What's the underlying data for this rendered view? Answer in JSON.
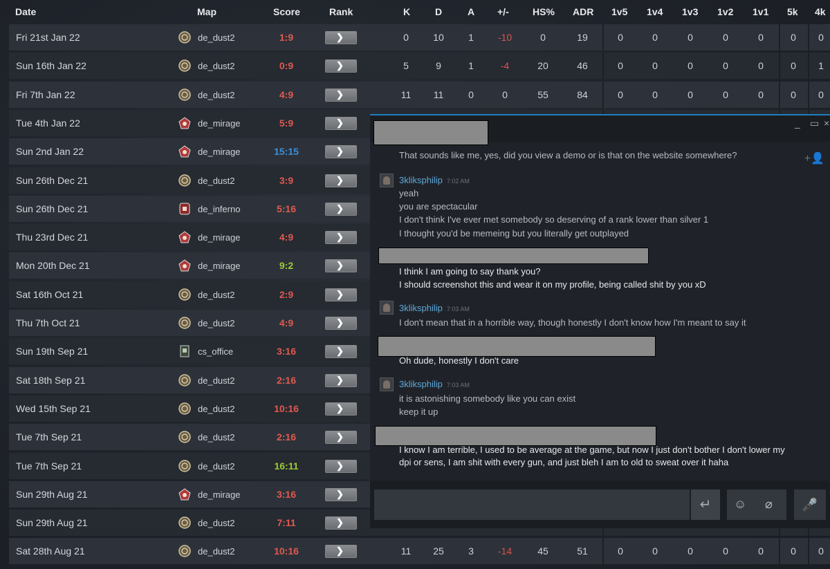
{
  "table": {
    "headers": {
      "date": "Date",
      "map": "Map",
      "score": "Score",
      "rank": "Rank",
      "k": "K",
      "d": "D",
      "a": "A",
      "pm": "+/-",
      "hs": "HS%",
      "adr": "ADR",
      "v5": "1v5",
      "v4": "1v4",
      "v3": "1v3",
      "v2": "1v2",
      "v1": "1v1",
      "k5": "5k",
      "k4": "4k"
    },
    "rank_glyph": "❯",
    "rows": [
      {
        "date": "Fri 21st Jan 22",
        "map": "de_dust2",
        "icon": "dust2",
        "score": "1:9",
        "score_color": "#e05a4f",
        "k": "0",
        "d": "10",
        "a": "1",
        "pm": "-10",
        "pm_color": "#d9534f",
        "hs": "0",
        "adr": "19",
        "v5": "0",
        "v4": "0",
        "v3": "0",
        "v2": "0",
        "v1": "0",
        "k5": "0",
        "k4": "0"
      },
      {
        "date": "Sun 16th Jan 22",
        "map": "de_dust2",
        "icon": "dust2",
        "score": "0:9",
        "score_color": "#e05a4f",
        "k": "5",
        "d": "9",
        "a": "1",
        "pm": "-4",
        "pm_color": "#d9534f",
        "hs": "20",
        "adr": "46",
        "v5": "0",
        "v4": "0",
        "v3": "0",
        "v2": "0",
        "v1": "0",
        "k5": "0",
        "k4": "1"
      },
      {
        "date": "Fri 7th Jan 22",
        "map": "de_dust2",
        "icon": "dust2",
        "score": "4:9",
        "score_color": "#e05a4f",
        "k": "11",
        "d": "11",
        "a": "0",
        "pm": "0",
        "pm_color": "#cfd2d6",
        "hs": "55",
        "adr": "84",
        "v5": "0",
        "v4": "0",
        "v3": "0",
        "v2": "0",
        "v1": "0",
        "k5": "0",
        "k4": "0"
      },
      {
        "date": "Tue 4th Jan 22",
        "map": "de_mirage",
        "icon": "mirage",
        "score": "5:9",
        "score_color": "#e05a4f"
      },
      {
        "date": "Sun 2nd Jan 22",
        "map": "de_mirage",
        "icon": "mirage",
        "score": "15:15",
        "score_color": "#3b8fd9"
      },
      {
        "date": "Sun 26th Dec 21",
        "map": "de_dust2",
        "icon": "dust2",
        "score": "3:9",
        "score_color": "#e05a4f"
      },
      {
        "date": "Sun 26th Dec 21",
        "map": "de_inferno",
        "icon": "inferno",
        "score": "5:16",
        "score_color": "#e05a4f"
      },
      {
        "date": "Thu 23rd Dec 21",
        "map": "de_mirage",
        "icon": "mirage",
        "score": "4:9",
        "score_color": "#e05a4f"
      },
      {
        "date": "Mon 20th Dec 21",
        "map": "de_mirage",
        "icon": "mirage",
        "score": "9:2",
        "score_color": "#9acd32"
      },
      {
        "date": "Sat 16th Oct 21",
        "map": "de_dust2",
        "icon": "dust2",
        "score": "2:9",
        "score_color": "#e05a4f"
      },
      {
        "date": "Thu 7th Oct 21",
        "map": "de_dust2",
        "icon": "dust2",
        "score": "4:9",
        "score_color": "#e05a4f"
      },
      {
        "date": "Sun 19th Sep 21",
        "map": "cs_office",
        "icon": "office",
        "score": "3:16",
        "score_color": "#e05a4f"
      },
      {
        "date": "Sat 18th Sep 21",
        "map": "de_dust2",
        "icon": "dust2",
        "score": "2:16",
        "score_color": "#e05a4f"
      },
      {
        "date": "Wed 15th Sep 21",
        "map": "de_dust2",
        "icon": "dust2",
        "score": "10:16",
        "score_color": "#e05a4f"
      },
      {
        "date": "Tue 7th Sep 21",
        "map": "de_dust2",
        "icon": "dust2",
        "score": "2:16",
        "score_color": "#e05a4f"
      },
      {
        "date": "Tue 7th Sep 21",
        "map": "de_dust2",
        "icon": "dust2",
        "score": "16:11",
        "score_color": "#9acd32"
      },
      {
        "date": "Sun 29th Aug 21",
        "map": "de_mirage",
        "icon": "mirage",
        "score": "3:16",
        "score_color": "#e05a4f"
      },
      {
        "date": "Sun 29th Aug 21",
        "map": "de_dust2",
        "icon": "dust2",
        "score": "7:11",
        "score_color": "#e05a4f"
      },
      {
        "date": "Sat 28th Aug 21",
        "map": "de_dust2",
        "icon": "dust2",
        "score": "10:16",
        "score_color": "#e05a4f",
        "k": "11",
        "d": "25",
        "a": "3",
        "pm": "-14",
        "pm_color": "#d9534f",
        "hs": "45",
        "adr": "51",
        "v5": "0",
        "v4": "0",
        "v3": "0",
        "v2": "0",
        "v1": "0",
        "k5": "0",
        "k4": "0"
      }
    ]
  },
  "chat": {
    "window_controls": {
      "minimize": "_",
      "maximize": "▭",
      "close": "×"
    },
    "msg_top": "That sounds like me, yes, did you view a demo or is that on the website somewhere?",
    "author1": {
      "name": "3kliksphilip",
      "time": "7:02 AM"
    },
    "block1": [
      "yeah",
      "you are spectacular",
      "I don't think I've ever met somebody so deserving of a rank lower than silver 1",
      "I thought you'd be memeing but you literally get outplayed"
    ],
    "block2": [
      "I think I am going to say thank you?",
      "I should screenshot this and wear it on my profile, being called shit by you xD"
    ],
    "author2": {
      "name": "3kliksphilip",
      "time": "7:03 AM"
    },
    "block3": [
      "I don't mean that in a horrible way, though honestly I don't know how I'm meant to say it"
    ],
    "block4": [
      "Oh dude, honestly I don't care"
    ],
    "author3": {
      "name": "3kliksphilip",
      "time": "7:03 AM"
    },
    "block5": [
      "it is astonishing somebody like you can exist",
      "keep it up"
    ],
    "block6": [
      "I know I am terrible, I used to be average at the game, but now I just don't bother I don't lower my",
      "dpi or sens, I am shit with every gun, and just bleh I am to old to sweat over it haha"
    ],
    "icons": {
      "send": "↵",
      "emoji": "☺",
      "attach": "⌀",
      "mic": "🎤",
      "add_user": "+👤"
    }
  }
}
